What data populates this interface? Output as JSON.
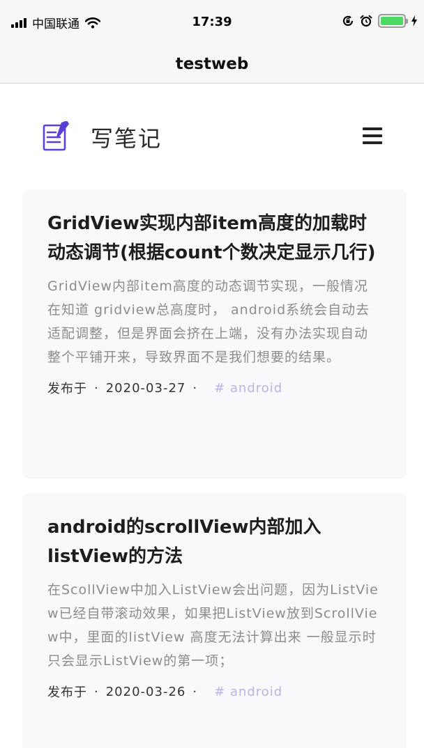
{
  "status_bar": {
    "carrier": "中国联通",
    "time": "17:39"
  },
  "nav": {
    "title": "testweb"
  },
  "site": {
    "title": "写笔记"
  },
  "posts": [
    {
      "title": "GridView实现内部item高度的加载时动态调节(根据count个数决定显示几行)",
      "excerpt": "GridView内部item高度的动态调节实现，一般情况在知道 gridview总高度时， android系统会自动去适配调整，但是界面会挤在上端，没有办法实现自动整个平铺开来，导致界面不是我们想要的结果。",
      "meta_label": "发布于",
      "date": "2020-03-27",
      "tag": "# android"
    },
    {
      "title": "android的scrollView内部加入listView的方法",
      "excerpt": "在ScollView中加入ListView会出问题，因为ListView已经自带滚动效果，如果把ListView放到ScrollView中，里面的listView 高度无法计算出来 一般显示时只会显示ListView的第一项；",
      "meta_label": "发布于",
      "date": "2020-03-26",
      "tag": "# android"
    }
  ],
  "icons": {
    "signal": "signal-bars-icon",
    "wifi": "wifi-icon",
    "rotation_lock": "rotation-lock-icon",
    "alarm": "alarm-clock-icon",
    "battery": "battery-icon",
    "charging": "charging-bolt-icon",
    "logo": "notebook-pen-icon",
    "menu": "hamburger-menu-icon"
  },
  "colors": {
    "logo": "#5b3fd6",
    "tag": "#b9b4e6",
    "battery": "#4cd964",
    "card_background": "#f9f9fb"
  }
}
